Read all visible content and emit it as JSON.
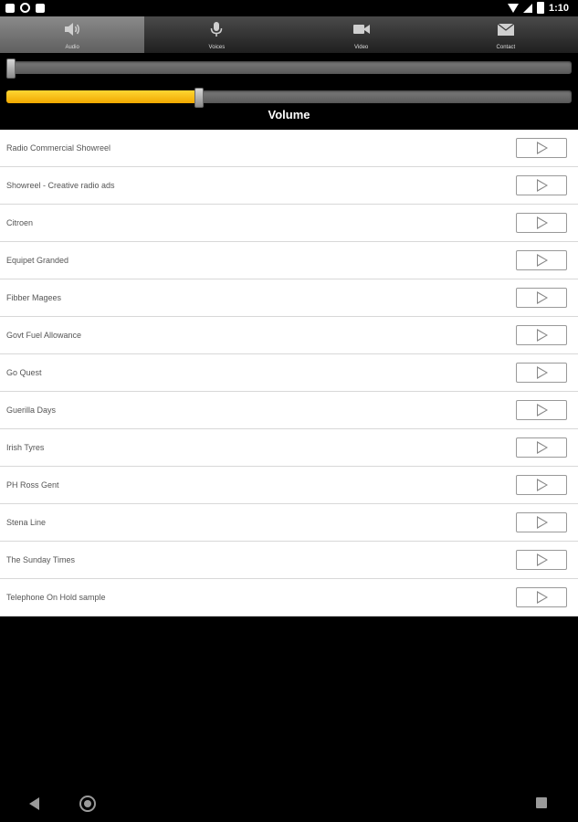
{
  "status_bar": {
    "time": "1:10"
  },
  "tabs": [
    {
      "label": "Audio",
      "icon": "speaker-icon",
      "active": true
    },
    {
      "label": "Voices",
      "icon": "microphone-icon",
      "active": false
    },
    {
      "label": "Video",
      "icon": "video-camera-icon",
      "active": false
    },
    {
      "label": "Contact",
      "icon": "envelope-icon",
      "active": false
    }
  ],
  "player": {
    "progress_fraction": 0.0,
    "volume_fraction": 0.34,
    "volume_label": "Volume"
  },
  "tracks": [
    {
      "title": "Radio Commercial Showreel"
    },
    {
      "title": "Showreel - Creative radio ads"
    },
    {
      "title": "Citroen"
    },
    {
      "title": "Equipet Granded"
    },
    {
      "title": "Fibber Magees"
    },
    {
      "title": "Govt Fuel Allowance"
    },
    {
      "title": "Go Quest"
    },
    {
      "title": "Guerilla Days"
    },
    {
      "title": "Irish Tyres"
    },
    {
      "title": "PH Ross Gent"
    },
    {
      "title": "Stena Line"
    },
    {
      "title": "The Sunday Times"
    },
    {
      "title": "Telephone On Hold sample"
    }
  ],
  "colors": {
    "accent": "#f5b800",
    "tab_active": "#7a7a7a",
    "background": "#000000"
  }
}
